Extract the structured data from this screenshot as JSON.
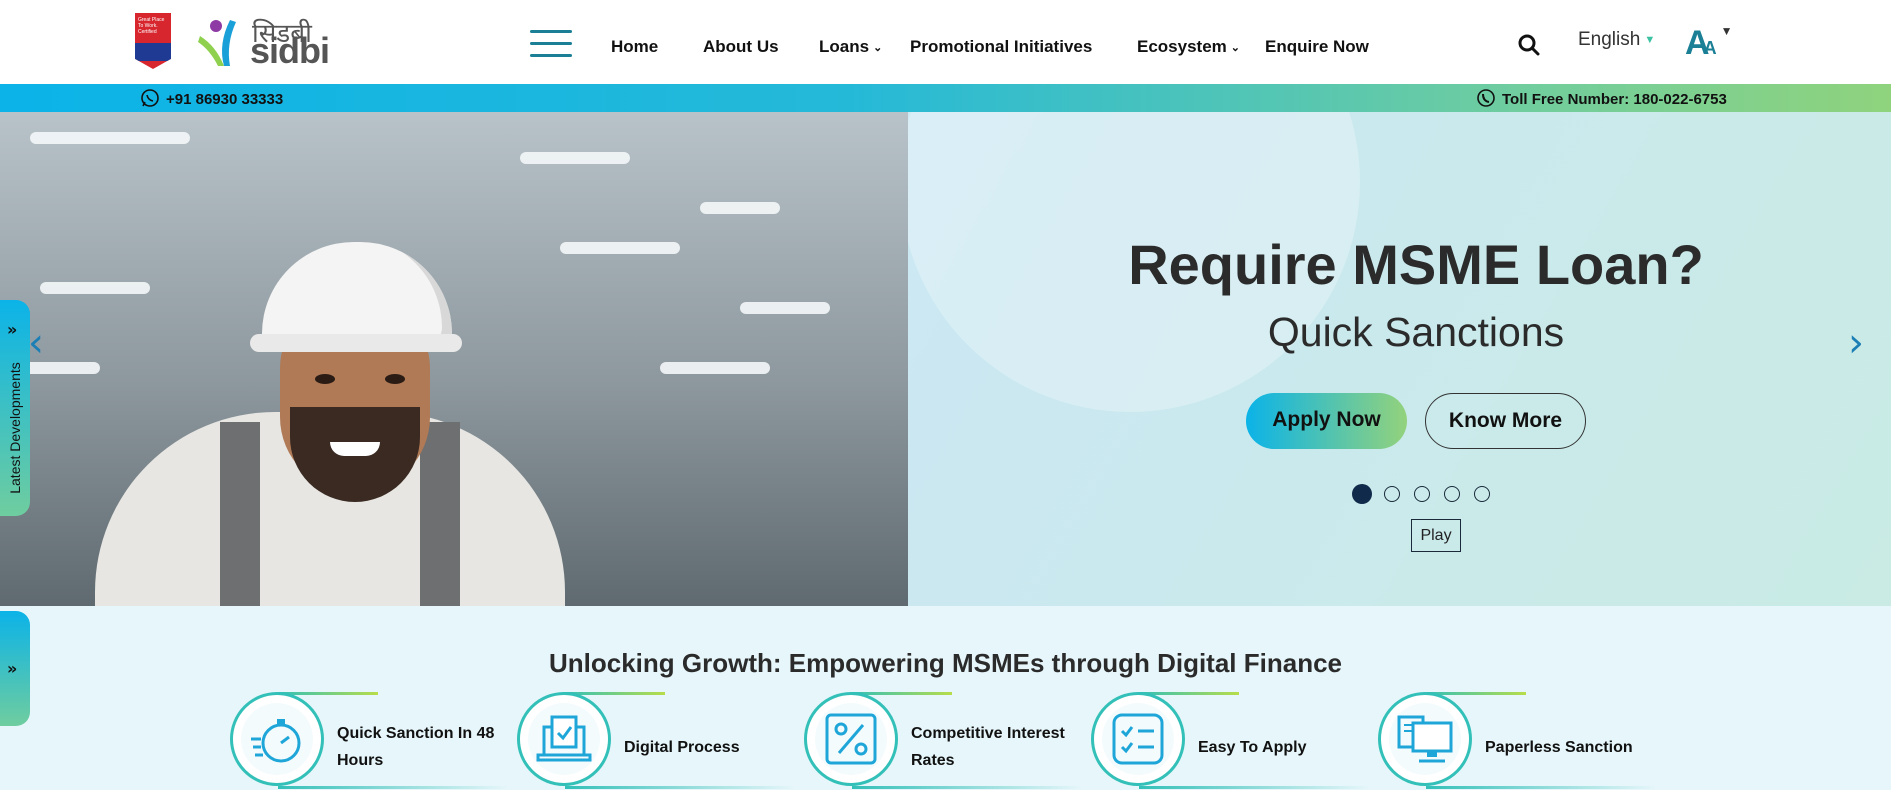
{
  "header": {
    "gptw_badge_text": "Great Place To Work. Certified",
    "logo_hindi": "सिडबी",
    "logo_english": "sidbi",
    "nav": [
      {
        "label": "Home",
        "has_dropdown": false
      },
      {
        "label": "About Us",
        "has_dropdown": false
      },
      {
        "label": "Loans",
        "has_dropdown": true
      },
      {
        "label": "Promotional Initiatives",
        "has_dropdown": false
      },
      {
        "label": "Ecosystem",
        "has_dropdown": true
      },
      {
        "label": "Enquire Now",
        "has_dropdown": false
      }
    ],
    "language": "English",
    "font_control_big": "A",
    "font_control_small": "A"
  },
  "contact_bar": {
    "whatsapp": "+91 86930 33333",
    "toll_free": "Toll Free Number: 180-022-6753"
  },
  "hero": {
    "headline": "Require MSME Loan?",
    "subheadline": "Quick Sanctions",
    "apply_label": "Apply Now",
    "know_more_label": "Know More",
    "slides_total": 5,
    "active_slide": 1,
    "play_label": "Play",
    "prev_arrow": "‹",
    "next_arrow": "›"
  },
  "side_tabs": {
    "latest_label": "Latest Developments",
    "chevrons": "»"
  },
  "features": {
    "title": "Unlocking Growth: Empowering MSMEs through Digital Finance",
    "items": [
      {
        "label": "Quick Sanction In 48 Hours",
        "icon": "stopwatch-icon"
      },
      {
        "label": "Digital Process",
        "icon": "laptop-document-icon"
      },
      {
        "label": "Competitive Interest Rates",
        "icon": "percent-icon"
      },
      {
        "label": "Easy To Apply",
        "icon": "checklist-icon"
      },
      {
        "label": "Paperless Sanction",
        "icon": "computer-icon"
      }
    ]
  },
  "colors": {
    "accent_blue": "#0bb3e8",
    "accent_green": "#93d27c",
    "nav_teal": "#1b7f96"
  }
}
